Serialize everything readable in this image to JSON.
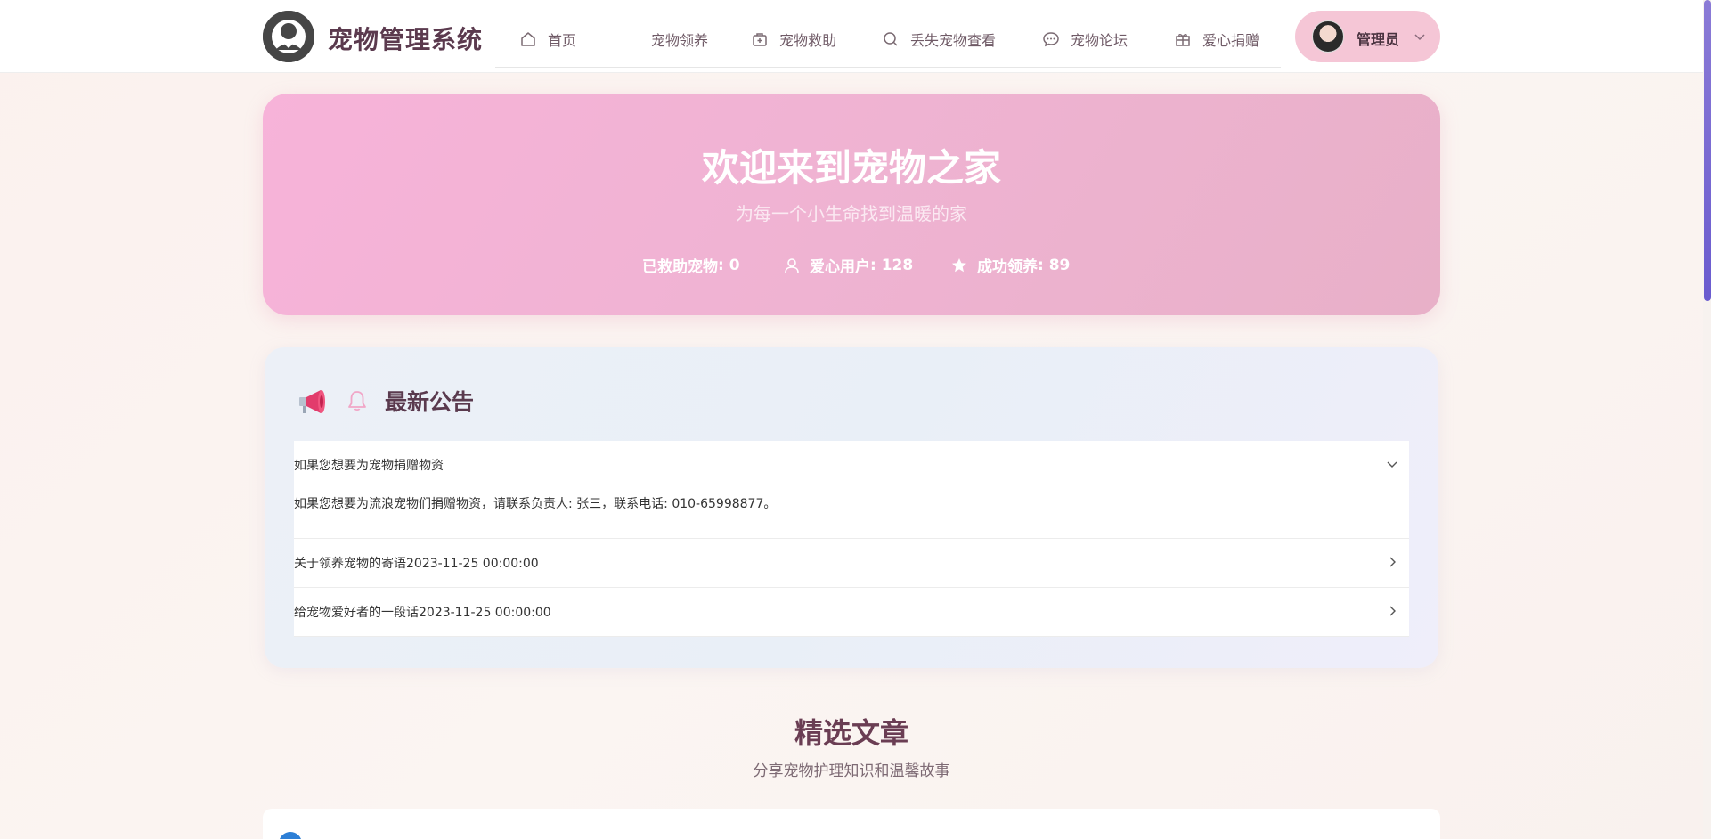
{
  "app": {
    "title": "宠物管理系统"
  },
  "nav": {
    "items": [
      {
        "label": "首页",
        "icon": "home-icon"
      },
      {
        "label": "宠物领养",
        "icon": ""
      },
      {
        "label": "宠物救助",
        "icon": "medical-kit-icon"
      },
      {
        "label": "丢失宠物查看",
        "icon": "search-icon"
      },
      {
        "label": "宠物论坛",
        "icon": "chat-icon"
      },
      {
        "label": "爱心捐赠",
        "icon": "gift-icon"
      }
    ]
  },
  "user": {
    "name": "管理员"
  },
  "hero": {
    "title": "欢迎来到宠物之家",
    "subtitle": "为每一个小生命找到温暖的家",
    "stats": [
      {
        "label": "已救助宠物",
        "value": "0",
        "icon": ""
      },
      {
        "label": "爱心用户",
        "value": "128",
        "icon": "user-icon"
      },
      {
        "label": "成功领养",
        "value": "89",
        "icon": "star-icon"
      }
    ]
  },
  "announcements": {
    "title": "最新公告",
    "items": [
      {
        "title": "如果您想要为宠物捐赠物资",
        "content": "如果您想要为流浪宠物们捐赠物资，请联系负责人: 张三，联系电话: 010-65998877。",
        "expanded": true
      },
      {
        "title": "关于领养宠物的寄语2023-11-25 00:00:00",
        "expanded": false
      },
      {
        "title": "给宠物爱好者的一段话2023-11-25 00:00:00",
        "expanded": false
      }
    ]
  },
  "articles": {
    "title": "精选文章",
    "subtitle": "分享宠物护理知识和温馨故事"
  },
  "colors": {
    "accent_pink": "#f5c6d6",
    "hero_gradient_start": "#f7b3d9",
    "hero_gradient_end": "#e8b0c8",
    "heading_plum": "#6a3d53"
  }
}
